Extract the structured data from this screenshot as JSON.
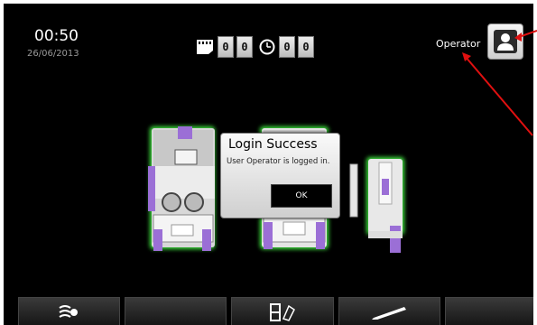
{
  "header": {
    "time": "00:50",
    "date": "26/06/2013",
    "counter_left": [
      "0",
      "0"
    ],
    "counter_right": [
      "0",
      "0"
    ],
    "operator_label": "Operator"
  },
  "dialog": {
    "title": "Login Success",
    "message": "User Operator is logged in.",
    "ok_label": "OK"
  },
  "softkeys": [
    {
      "icon": "fan-icon"
    },
    {
      "icon": ""
    },
    {
      "icon": "cassette-tilt-icon"
    },
    {
      "icon": "pen-icon"
    },
    {
      "icon": ""
    }
  ],
  "colors": {
    "accent_purple": "#9b6fd6",
    "glow_green": "#3ee23e",
    "annotation_red": "#e01010"
  }
}
